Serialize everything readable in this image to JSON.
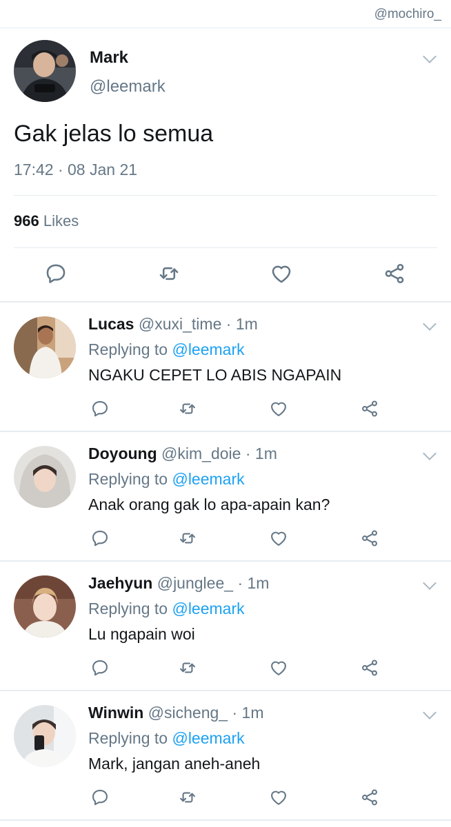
{
  "watermark": "@mochiro_",
  "colors": {
    "link": "#1da1f2",
    "secondary_text": "#657786",
    "divider": "#e6ecf0"
  },
  "main_tweet": {
    "name": "Mark",
    "handle": "@leemark",
    "text": "Gak jelas lo semua",
    "timestamp": "17:42 · 08 Jan 21",
    "likes_count": "966",
    "likes_label": "Likes",
    "actions": [
      "reply-icon",
      "retweet-icon",
      "like-icon",
      "share-icon"
    ]
  },
  "replies": [
    {
      "name": "Lucas",
      "handle": "@xuxi_time",
      "dot": "·",
      "time": "1m",
      "replying_prefix": "Replying to",
      "replying_to": "@leemark",
      "text": "NGAKU CEPET LO ABIS NGAPAIN"
    },
    {
      "name": "Doyoung",
      "handle": "@kim_doie",
      "dot": "·",
      "time": "1m",
      "replying_prefix": "Replying to",
      "replying_to": "@leemark",
      "text": "Anak orang gak lo apa-apain kan?"
    },
    {
      "name": "Jaehyun",
      "handle": "@junglee_",
      "dot": "·",
      "time": "1m",
      "replying_prefix": "Replying to",
      "replying_to": "@leemark",
      "text": "Lu ngapain woi"
    },
    {
      "name": "Winwin",
      "handle": "@sicheng_",
      "dot": "·",
      "time": "1m",
      "replying_prefix": "Replying to",
      "replying_to": "@leemark",
      "text": "Mark, jangan aneh-aneh"
    }
  ]
}
